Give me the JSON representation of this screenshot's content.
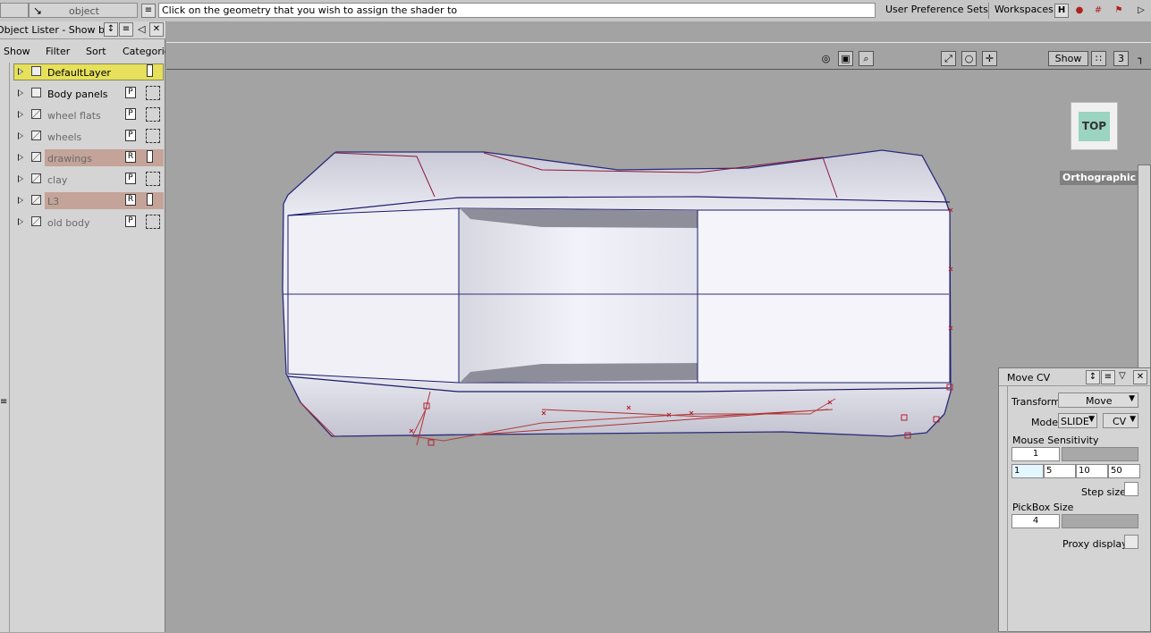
{
  "topbar": {
    "pick_mode": "object",
    "prompt": "Click on the geometry that you wish to assign the shader to",
    "user_pref_label": "User Preference Sets",
    "workspaces_label": "Workspaces"
  },
  "lister": {
    "title": "Object Lister - Show by Layer",
    "menu": [
      "Show",
      "Filter",
      "Sort",
      "Categories"
    ],
    "layers": [
      {
        "label": "DefaultLayer",
        "mode": "",
        "highlight": "#e6e05a",
        "slash": false,
        "dim": false
      },
      {
        "label": "Body panels",
        "mode": "P",
        "highlight": "",
        "slash": false,
        "dim": false
      },
      {
        "label": "wheel flats",
        "mode": "P",
        "highlight": "",
        "slash": true,
        "dim": true
      },
      {
        "label": "wheels",
        "mode": "P",
        "highlight": "",
        "slash": true,
        "dim": true
      },
      {
        "label": "drawings",
        "mode": "R",
        "highlight": "#c4a399",
        "slash": true,
        "dim": true
      },
      {
        "label": "clay",
        "mode": "P",
        "highlight": "",
        "slash": true,
        "dim": true
      },
      {
        "label": "L3",
        "mode": "R",
        "highlight": "#c4a399",
        "slash": true,
        "dim": true
      },
      {
        "label": "old body",
        "mode": "P",
        "highlight": "",
        "slash": true,
        "dim": true
      }
    ]
  },
  "viewport": {
    "show_label": "Show",
    "view_number": "3",
    "view_cube_label": "TOP",
    "projection_label": "Orthographic"
  },
  "movecv": {
    "title": "Move CV",
    "transform_label": "Transform",
    "transform_value": "Move",
    "mode_label": "Mode",
    "mode_value": "SLIDE",
    "mode_target": "CV",
    "sensitivity_label": "Mouse Sensitivity",
    "sensitivity_value": "1",
    "sensitivity_presets": [
      "1",
      "5",
      "10",
      "50"
    ],
    "step_size_label": "Step size",
    "pickbox_label": "PickBox Size",
    "pickbox_value": "4",
    "proxy_label": "Proxy display"
  },
  "colors": {
    "viewport_bg": "#a3a3a3",
    "panel_bg": "#d4d4d4",
    "layer_active": "#e6e05a",
    "layer_reference": "#c4a399",
    "curve_blue": "#1a1a7a",
    "curve_red": "#b0203a",
    "view_cube": "#9bd4c0"
  }
}
